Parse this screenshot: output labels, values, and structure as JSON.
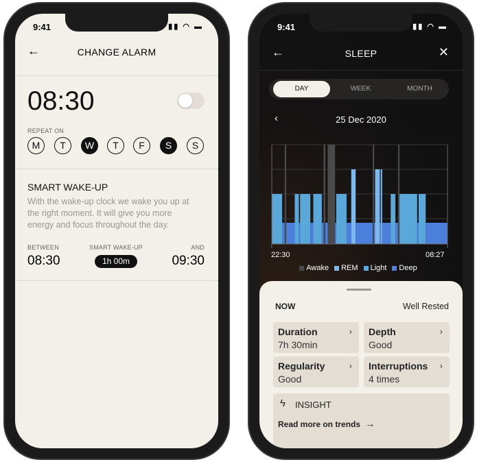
{
  "status": {
    "time": "9:41"
  },
  "alarm": {
    "title": "CHANGE ALARM",
    "time": "08:30",
    "enabled": false,
    "repeat_label": "REPEAT ON",
    "days": [
      {
        "l": "M",
        "on": false
      },
      {
        "l": "T",
        "on": false
      },
      {
        "l": "W",
        "on": true
      },
      {
        "l": "T",
        "on": false
      },
      {
        "l": "F",
        "on": false
      },
      {
        "l": "S",
        "on": true
      },
      {
        "l": "S",
        "on": false
      }
    ],
    "smart_title": "SMART WAKE-UP",
    "smart_desc": "With the wake-up clock we wake you up at the right moment. It will give you more energy and focus throughout the day.",
    "between_label": "BETWEEN",
    "between": "08:30",
    "window_label": "SMART WAKE-UP",
    "window": "1h 00m",
    "and_label": "AND",
    "and": "09:30"
  },
  "sleep": {
    "title": "SLEEP",
    "tabs": [
      {
        "label": "DAY",
        "active": true
      },
      {
        "label": "WEEK",
        "active": false
      },
      {
        "label": "MONTH",
        "active": false
      }
    ],
    "date": "25 Dec 2020",
    "colors": {
      "Awake": "#4a4a4a",
      "REM": "#7bb8ef",
      "Light": "#5aa8da",
      "Deep": "#4d7fdc"
    },
    "now_label": "NOW",
    "now_value": "Well Rested",
    "cards": [
      {
        "k": "Duration",
        "v": "7h 30min"
      },
      {
        "k": "Depth",
        "v": "Good"
      },
      {
        "k": "Regularity",
        "v": "Good"
      },
      {
        "k": "Interruptions",
        "v": "4 times"
      }
    ],
    "insight_title": "INSIGHT",
    "insight_link": "Read more on trends"
  },
  "chart_data": {
    "type": "hypnogram",
    "x_start": "22:30",
    "x_end": "08:27",
    "levels": [
      "Deep",
      "Light",
      "REM",
      "Awake"
    ],
    "legend": [
      "Awake",
      "REM",
      "Light",
      "Deep"
    ],
    "legend_placement": "bottom",
    "grid": true,
    "segments": [
      [
        "Light",
        "22:30",
        "23:05"
      ],
      [
        "Deep",
        "23:05",
        "23:14"
      ],
      [
        "Awake",
        "23:14",
        "23:19"
      ],
      [
        "Deep",
        "23:19",
        "23:48"
      ],
      [
        "Light",
        "23:48",
        "00:02"
      ],
      [
        "Deep",
        "00:02",
        "00:06"
      ],
      [
        "Light",
        "00:06",
        "00:41"
      ],
      [
        "Deep",
        "00:41",
        "00:51"
      ],
      [
        "Light",
        "00:51",
        "01:20"
      ],
      [
        "Deep",
        "01:20",
        "01:26"
      ],
      [
        "Awake",
        "01:26",
        "01:32"
      ],
      [
        "Deep",
        "01:32",
        "01:40"
      ],
      [
        "Awake",
        "01:40",
        "02:05"
      ],
      [
        "Deep",
        "02:05",
        "02:09"
      ],
      [
        "Light",
        "02:09",
        "02:44"
      ],
      [
        "Deep",
        "02:44",
        "03:00"
      ],
      [
        "REM",
        "03:00",
        "03:15"
      ],
      [
        "Deep",
        "03:15",
        "04:13"
      ],
      [
        "Awake",
        "04:13",
        "04:18"
      ],
      [
        "Deep",
        "04:18",
        "04:21"
      ],
      [
        "REM",
        "04:21",
        "04:37"
      ],
      [
        "Deep",
        "04:37",
        "04:40"
      ],
      [
        "REM",
        "04:40",
        "04:45"
      ],
      [
        "Deep",
        "04:45",
        "05:14"
      ],
      [
        "Light",
        "05:14",
        "05:30"
      ],
      [
        "Deep",
        "05:30",
        "05:39"
      ],
      [
        "Awake",
        "05:39",
        "05:44"
      ],
      [
        "Light",
        "05:44",
        "06:44"
      ],
      [
        "Deep",
        "06:44",
        "06:49"
      ],
      [
        "Light",
        "06:49",
        "07:13"
      ],
      [
        "Deep",
        "07:13",
        "08:27"
      ]
    ]
  }
}
